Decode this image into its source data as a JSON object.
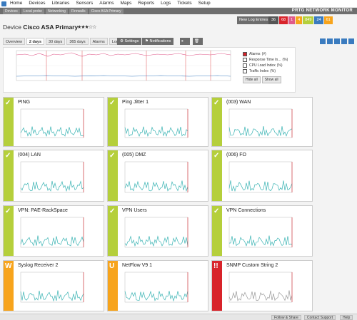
{
  "nav": {
    "items": [
      "Home",
      "Devices",
      "Libraries",
      "Sensors",
      "Alarms",
      "Maps",
      "Reports",
      "Logs",
      "Tickets",
      "Setup"
    ]
  },
  "breadcrumb": [
    "Devices",
    "Local probe",
    "Networking",
    "Firewalls",
    "Cisco ASA Primary"
  ],
  "brand": "PRTG NETWORK MONITOR",
  "device": {
    "prefix": "Device",
    "name": "Cisco ASA Primary",
    "stars": "★★★☆☆"
  },
  "log_entries": {
    "label": "New Log Entries",
    "count": "36"
  },
  "status_badges": [
    {
      "text": "68",
      "color": "#d8232a"
    },
    {
      "text": "1",
      "color": "#e05a8a"
    },
    {
      "text": "4",
      "color": "#f7a41c"
    },
    {
      "text": "849",
      "color": "#b5cf3b"
    },
    {
      "text": "24",
      "color": "#3a7bbf"
    },
    {
      "text": "61",
      "color": "#f7a41c"
    }
  ],
  "tabs": [
    "Overview",
    "2 days",
    "30 days",
    "365 days",
    "Alarms",
    "Log"
  ],
  "active_tab": "2 days",
  "buttons": {
    "settings": "Settings",
    "notifications": "Notifications"
  },
  "legend": {
    "items": [
      {
        "label": "Alarms",
        "color": "#d8232a"
      },
      {
        "label": "Response Time In...",
        "color": "#ffffff"
      },
      {
        "label": "CPU Load Index",
        "color": "#ffffff"
      },
      {
        "label": "Traffic Index",
        "color": "#ffffff"
      }
    ],
    "units": [
      "(#)",
      "(%)",
      "(%)",
      "(%)"
    ],
    "hide_all": "Hide all",
    "show_all": "Show all"
  },
  "sensors": [
    {
      "name": "PING",
      "status": "ok",
      "mark": "✓"
    },
    {
      "name": "Ping Jitter 1",
      "status": "ok",
      "mark": "✓"
    },
    {
      "name": "(003) WAN",
      "status": "ok",
      "mark": "✓"
    },
    {
      "name": "(004) LAN",
      "status": "ok",
      "mark": "✓"
    },
    {
      "name": "(005) DMZ",
      "status": "ok",
      "mark": "✓"
    },
    {
      "name": "(006) FO",
      "status": "ok",
      "mark": "✓"
    },
    {
      "name": "VPN: PAE-RackSpace",
      "status": "ok",
      "mark": "✓"
    },
    {
      "name": "VPN Users",
      "status": "ok",
      "mark": "✓"
    },
    {
      "name": "VPN Connections",
      "status": "ok",
      "mark": "✓"
    },
    {
      "name": "Syslog Receiver 2",
      "status": "warn",
      "mark": "W"
    },
    {
      "name": "NetFlow V9 1",
      "status": "warn",
      "mark": "U"
    },
    {
      "name": "SNMP Custom String 2",
      "status": "down",
      "mark": "!!"
    }
  ],
  "footer": {
    "follow": "Follow & Share",
    "contact": "Contact Support",
    "help": "Help"
  }
}
